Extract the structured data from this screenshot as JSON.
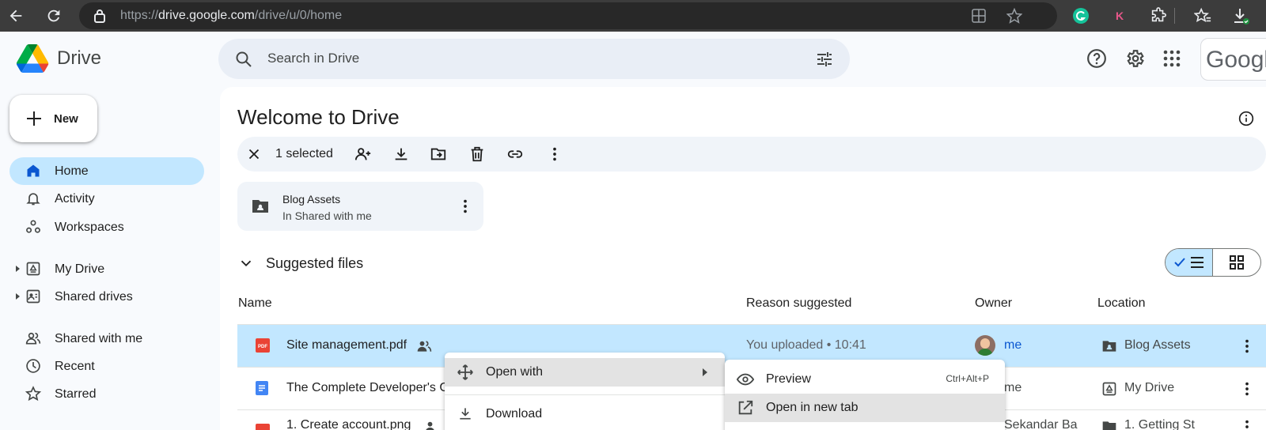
{
  "browser": {
    "url_prefix": "https://",
    "url_host": "drive.google.com",
    "url_path": "/drive/u/0/home",
    "extension_k": "K"
  },
  "header": {
    "app_name": "Drive",
    "search_placeholder": "Search in Drive",
    "account_text": "Google"
  },
  "sidebar": {
    "new_label": "New",
    "items": [
      {
        "label": "Home",
        "icon": "home-icon",
        "active": true
      },
      {
        "label": "Activity",
        "icon": "bell-icon"
      },
      {
        "label": "Workspaces",
        "icon": "workspaces-icon"
      },
      {
        "label": "My Drive",
        "icon": "my-drive-icon"
      },
      {
        "label": "Shared drives",
        "icon": "shared-drives-icon"
      },
      {
        "label": "Shared with me",
        "icon": "people-icon"
      },
      {
        "label": "Recent",
        "icon": "clock-icon"
      },
      {
        "label": "Starred",
        "icon": "star-icon"
      }
    ]
  },
  "main": {
    "title": "Welcome to Drive",
    "selection_text": "1 selected",
    "folder": {
      "name": "Blog Assets",
      "subtitle": "In Shared with me"
    },
    "section_title": "Suggested files",
    "columns": [
      "Name",
      "Reason suggested",
      "Owner",
      "Location"
    ],
    "rows": [
      {
        "name": "Site management.pdf",
        "type": "pdf",
        "reason": "You uploaded • 10:41",
        "owner": "me",
        "location": "Blog Assets",
        "selected": true
      },
      {
        "name": "The Complete Developer's G",
        "type": "doc",
        "reason": "",
        "owner": "me",
        "location": "My Drive"
      },
      {
        "name": "1. Create account.png",
        "type": "image",
        "reason": "",
        "owner": "Sekandar Ba",
        "location": "1. Getting St"
      }
    ]
  },
  "context_menu": {
    "items": [
      {
        "label": "Open with",
        "has_submenu": true,
        "highlighted": true
      },
      {
        "label": "Download"
      }
    ]
  },
  "submenu": {
    "items": [
      {
        "label": "Preview",
        "shortcut": "Ctrl+Alt+P"
      },
      {
        "label": "Open in new tab",
        "highlighted": true
      }
    ]
  },
  "colors": {
    "accent": "#0b57d0",
    "selected_bg": "#c2e7ff",
    "pdf_red": "#ea4335",
    "doc_blue": "#4285f4"
  }
}
